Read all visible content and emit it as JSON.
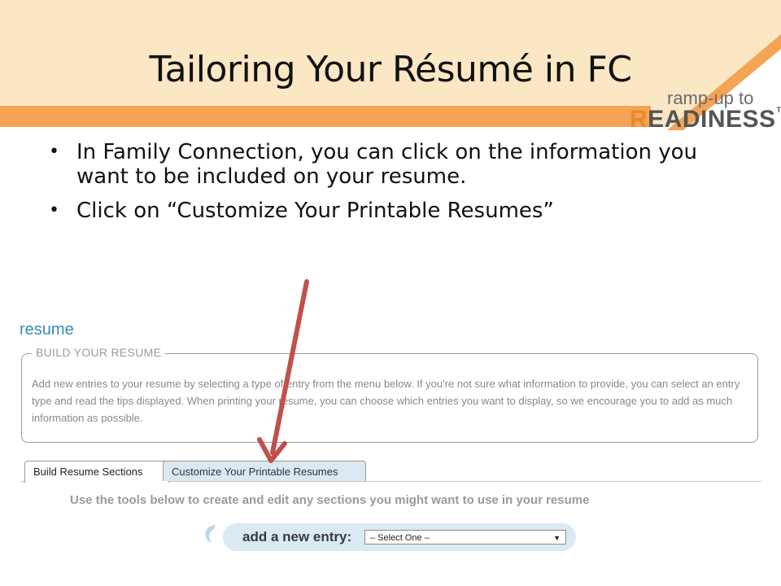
{
  "slide": {
    "title": "Tailoring Your Résumé in FC",
    "logo_top": "ramp-up  to",
    "logo_bottom_first": "R",
    "logo_bottom_rest": "EADINESS",
    "logo_tm": "TM",
    "bullets": [
      "In Family Connection, you can click on the information you want to be included on your resume.",
      "Click on “Customize Your Printable Resumes”"
    ]
  },
  "screenshot": {
    "heading": "resume",
    "build_legend": "BUILD YOUR RESUME",
    "build_text": "Add new entries to your resume by selecting a type of entry from the menu below. If you're not sure what information to provide, you can select an entry type and read the tips displayed. When printing your resume, you can choose which entries you want to display, so we encourage you to add as much information as possible.",
    "tabs": [
      "Build Resume Sections",
      "Customize Your Printable Resumes"
    ],
    "active_tab": "Build Resume Sections",
    "tools_text": "Use the tools below to create and edit any sections you might want to use in your resume",
    "add_entry_label": "add a new entry:",
    "select_value": "– Select One –"
  },
  "colors": {
    "header_band": "#fce7c4",
    "orange_stripe": "#f5a355",
    "heading_blue": "#2e8fb6",
    "arrow_red": "#c0504d",
    "pill_blue": "#d9eaf3"
  }
}
